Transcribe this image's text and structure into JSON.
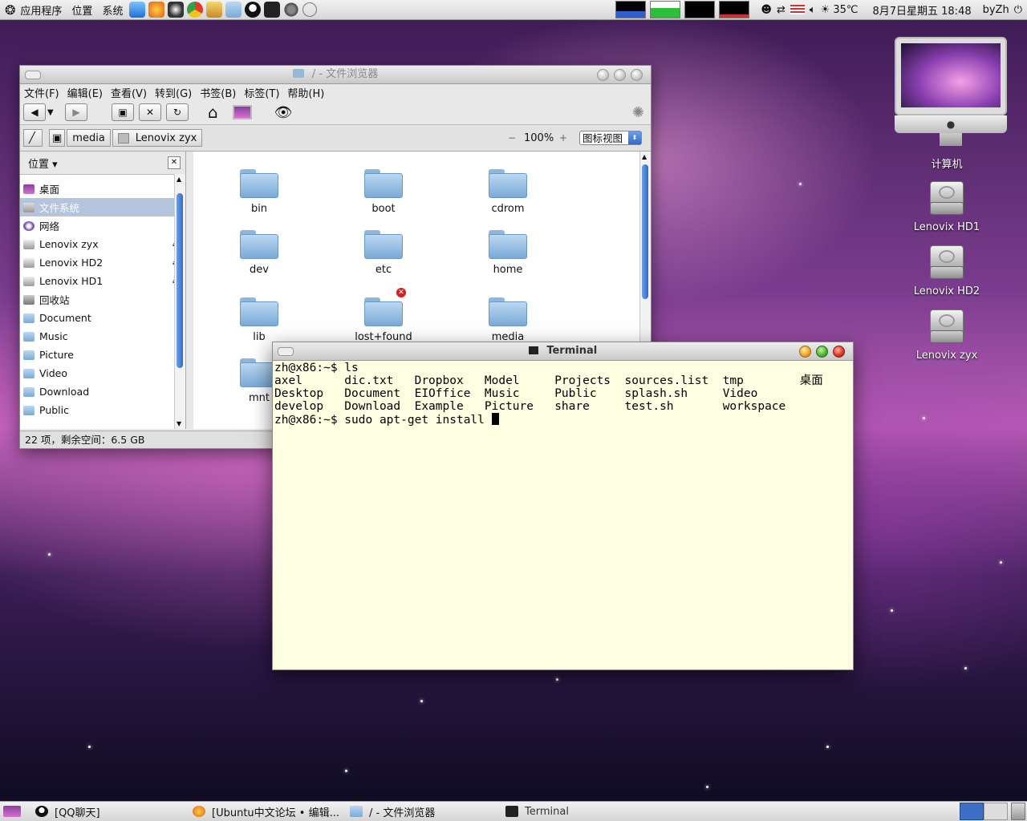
{
  "top_panel": {
    "menus": [
      "应用程序",
      "位置",
      "系统"
    ],
    "temperature": "35℃",
    "clock": "8月7日星期五 18:48",
    "user": "byZh"
  },
  "file_browser": {
    "title": "/ - 文件浏览器",
    "menus": [
      "文件(F)",
      "编辑(E)",
      "查看(V)",
      "转到(G)",
      "书签(B)",
      "标签(T)",
      "帮助(H)"
    ],
    "breadcrumbs": [
      "media",
      "Lenovix zyx"
    ],
    "zoom": "100%",
    "view_mode": "图标视图",
    "sidebar_header": "位置",
    "sidebar_items": [
      {
        "label": "桌面",
        "icon": "desktop-icon",
        "eject": false
      },
      {
        "label": "文件系统",
        "icon": "filesystem-icon",
        "eject": false
      },
      {
        "label": "网络",
        "icon": "network-icon",
        "eject": false
      },
      {
        "label": "Lenovix zyx",
        "icon": "drive-icon",
        "eject": true
      },
      {
        "label": "Lenovix HD2",
        "icon": "drive-icon",
        "eject": true
      },
      {
        "label": "Lenovix HD1",
        "icon": "drive-icon",
        "eject": true
      },
      {
        "label": "回收站",
        "icon": "trash-icon",
        "eject": false
      },
      {
        "label": "Document",
        "icon": "folder-icon",
        "eject": false
      },
      {
        "label": "Music",
        "icon": "folder-icon",
        "eject": false
      },
      {
        "label": "Picture",
        "icon": "folder-icon",
        "eject": false
      },
      {
        "label": "Video",
        "icon": "folder-icon",
        "eject": false
      },
      {
        "label": "Download",
        "icon": "folder-icon",
        "eject": false
      },
      {
        "label": "Public",
        "icon": "folder-icon",
        "eject": false
      }
    ],
    "folders": [
      "bin",
      "boot",
      "cdrom",
      "dev",
      "etc",
      "home",
      "lib",
      "lost+found",
      "media",
      "mnt"
    ],
    "status": "22 项，剩余空间：6.5 GB"
  },
  "terminal": {
    "title": "Terminal",
    "lines": [
      "zh@x86:~$ ls",
      "axel      dic.txt   Dropbox   Model     Projects  sources.list  tmp        桌面",
      "Desktop   Document  EIOffice  Music     Public    splash.sh     Video",
      "develop   Download  Example   Picture   share     test.sh       workspace"
    ],
    "prompt_line": "zh@x86:~$ sudo apt-get install "
  },
  "desktop_icons": [
    {
      "label": "计算机",
      "icon": "computer-icon"
    },
    {
      "label": "Lenovix HD1",
      "icon": "harddisk-icon"
    },
    {
      "label": "Lenovix HD2",
      "icon": "harddisk-icon"
    },
    {
      "label": "Lenovix zyx",
      "icon": "harddisk-icon"
    }
  ],
  "taskbar": {
    "items": [
      "[QQ聊天]",
      "[Ubuntu中文论坛 • 编辑...",
      "/ - 文件浏览器",
      "Terminal"
    ]
  },
  "colors": {
    "terminal_bg": "#fefee2",
    "sidebar_selected": "#b5c4dd",
    "scroll_thumb": "#2d6bcc"
  }
}
